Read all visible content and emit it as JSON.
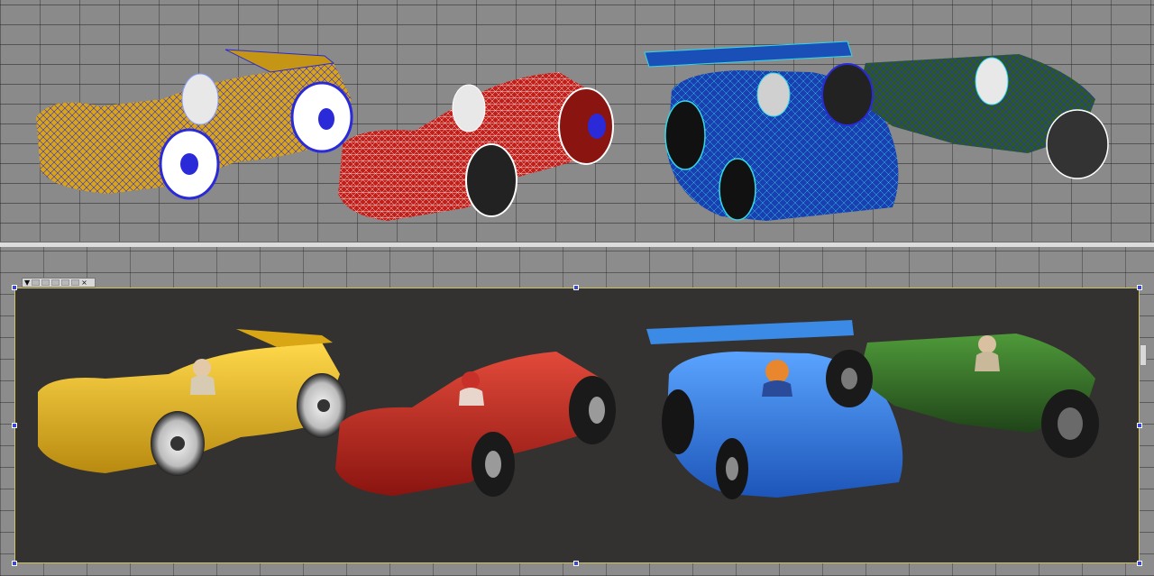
{
  "viewports": {
    "top": {
      "mode": "wireframe-shaded"
    },
    "bottom": {
      "mode": "rendered"
    }
  },
  "render_toolbar": {
    "menu_icon": "triangle-down-icon",
    "close_icon": "close-icon",
    "menu_glyph": "▼",
    "close_glyph": "×"
  },
  "cars": [
    {
      "id": "yellow",
      "color": "#e7b51c",
      "wire": "#2a2ad8"
    },
    {
      "id": "red",
      "color": "#c0221c",
      "wire": "#ffffff"
    },
    {
      "id": "blue",
      "color": "#2f6fd6",
      "wire": "#32d8e8"
    },
    {
      "id": "green",
      "color": "#2f6a25",
      "wire": "#2a2ad8"
    }
  ],
  "colors": {
    "render_bg": "#343230",
    "selection_border": "#cfc36a",
    "handle": "#3a48d8"
  }
}
